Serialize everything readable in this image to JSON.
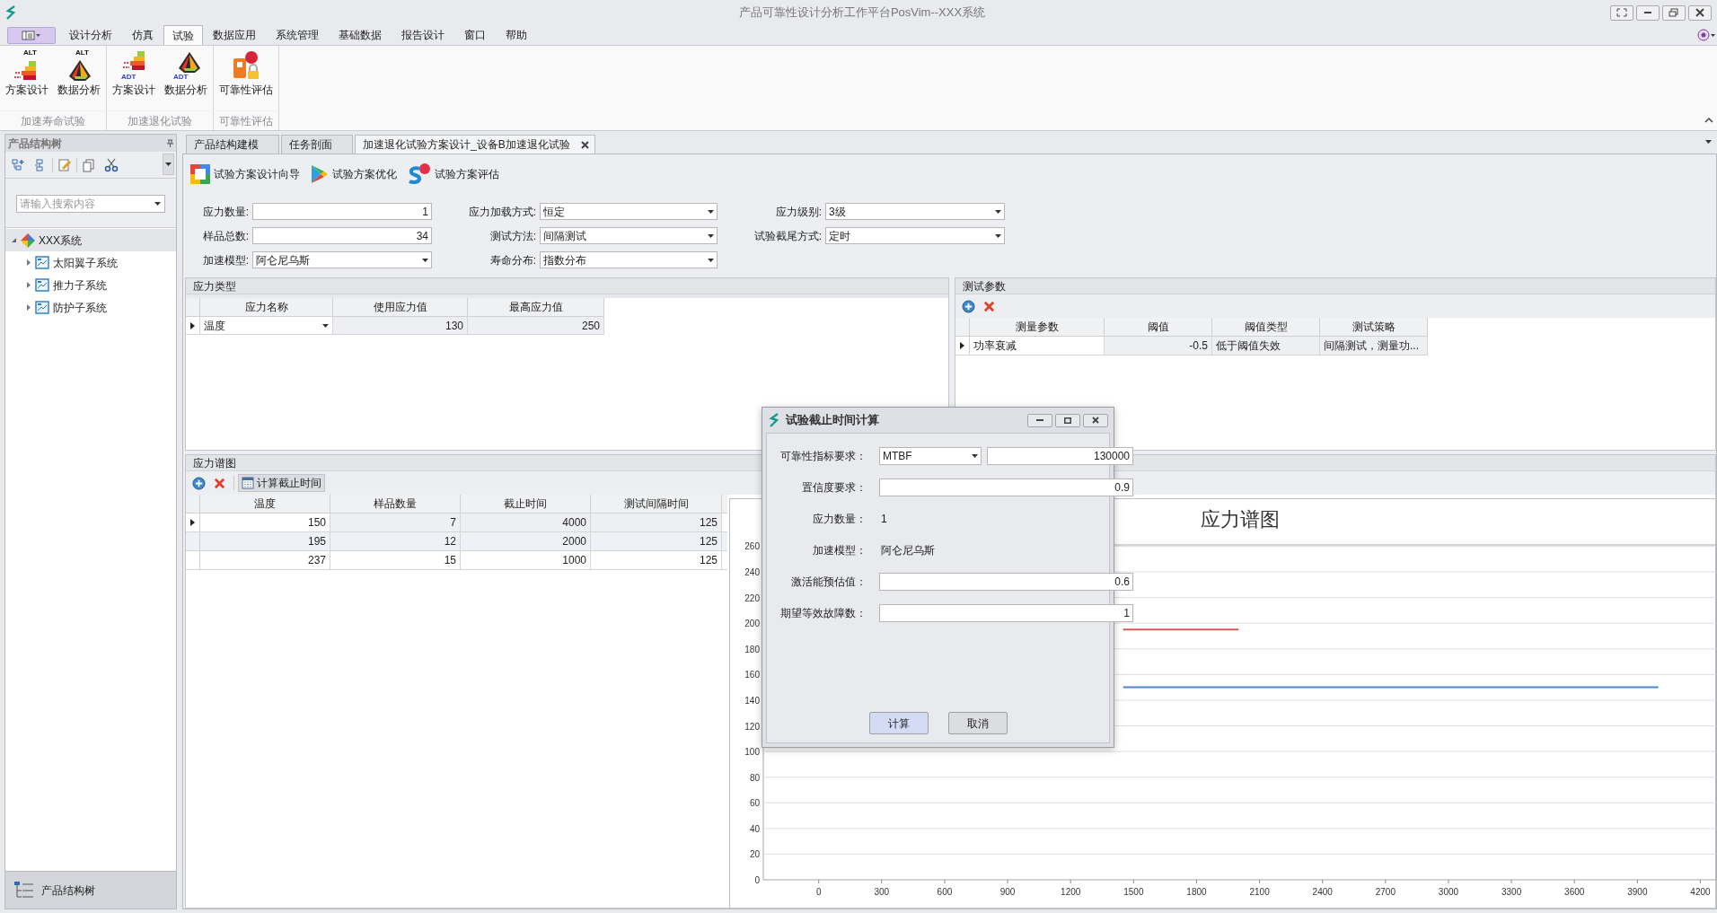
{
  "window": {
    "title": "产品可靠性设计分析工作平台PosVim--XXX系统"
  },
  "menu_tabs": [
    {
      "label": "设计分析",
      "selected": false
    },
    {
      "label": "仿真",
      "selected": false
    },
    {
      "label": "试验",
      "selected": true
    },
    {
      "label": "数据应用",
      "selected": false
    },
    {
      "label": "系统管理",
      "selected": false
    },
    {
      "label": "基础数据",
      "selected": false
    },
    {
      "label": "报告设计",
      "selected": false
    },
    {
      "label": "窗口",
      "selected": false
    },
    {
      "label": "帮助",
      "selected": false
    }
  ],
  "ribbon": {
    "groups": [
      {
        "label": "加速寿命试验",
        "buttons": [
          {
            "label": "方案设计",
            "kind": "design",
            "badge": "ALT"
          },
          {
            "label": "数据分析",
            "kind": "analysis",
            "badge": "ALT"
          }
        ]
      },
      {
        "label": "加速退化试验",
        "buttons": [
          {
            "label": "方案设计",
            "kind": "design",
            "badge": "ADT"
          },
          {
            "label": "数据分析",
            "kind": "analysis",
            "badge": "ADT"
          }
        ]
      },
      {
        "label": "可靠性评估",
        "buttons": [
          {
            "label": "可靠性评估",
            "kind": "reliability"
          }
        ]
      }
    ]
  },
  "left_panel": {
    "title": "产品结构树",
    "search": {
      "placeholder": "请输入搜索内容"
    },
    "tree": [
      {
        "label": "XXX系统",
        "kind": "system",
        "selected": true,
        "expanded": true,
        "children": [
          {
            "label": "太阳翼子系统",
            "kind": "subsystem",
            "selected": false,
            "expanded": false
          },
          {
            "label": "推力子系统",
            "kind": "subsystem",
            "selected": false,
            "expanded": false
          },
          {
            "label": "防护子系统",
            "kind": "subsystem",
            "selected": false,
            "expanded": false
          }
        ]
      }
    ],
    "footer_button": "产品结构树"
  },
  "document_tabs": [
    {
      "label": "产品结构建模",
      "selected": false
    },
    {
      "label": "任务剖面",
      "selected": false
    },
    {
      "label": "加速退化试验方案设计_设备B加速退化试验",
      "selected": true
    }
  ],
  "toolbar": [
    {
      "label": "试验方案设计向导",
      "kind": "wizard"
    },
    {
      "label": "试验方案优化",
      "kind": "optimize"
    },
    {
      "label": "试验方案评估",
      "kind": "evaluate"
    }
  ],
  "form_fields": [
    {
      "label": "应力数量:",
      "kind": "input",
      "value": "1"
    },
    {
      "label": "应力加载方式:",
      "kind": "combo",
      "value": "恒定"
    },
    {
      "label": "应力级别:",
      "kind": "combo",
      "value": "3级"
    },
    {
      "label": "样品总数:",
      "kind": "input",
      "value": "34"
    },
    {
      "label": "测试方法:",
      "kind": "combo",
      "value": "间隔测试"
    },
    {
      "label": "试验截尾方式:",
      "kind": "combo",
      "value": "定时"
    },
    {
      "label": "加速模型:",
      "kind": "combo",
      "value": "阿仑尼乌斯"
    },
    {
      "label": "寿命分布:",
      "kind": "combo",
      "value": "指数分布"
    }
  ],
  "stress_types": {
    "title": "应力类型",
    "columns": [
      "应力名称",
      "使用应力值",
      "最高应力值"
    ],
    "rows": [
      {
        "cells": [
          "温度",
          "130",
          "250"
        ],
        "selected": true
      }
    ]
  },
  "test_params": {
    "title": "测试参数",
    "columns": [
      "测量参数",
      "阈值",
      "阈值类型",
      "测试策略"
    ],
    "rows": [
      {
        "cells": [
          "功率衰减",
          "-0.5",
          "低于阈值失效",
          "间隔测试，测量功..."
        ],
        "selected": true
      }
    ]
  },
  "stress_spectrum": {
    "title": "应力谱图",
    "toolbar_button": "计算截止时间",
    "columns": [
      "温度",
      "样品数量",
      "截止时间",
      "测试间隔时间"
    ],
    "rows": [
      {
        "cells": [
          "150",
          "7",
          "4000",
          "125"
        ],
        "selected": true
      },
      {
        "cells": [
          "195",
          "12",
          "2000",
          "125"
        ],
        "selected": false
      },
      {
        "cells": [
          "237",
          "15",
          "1000",
          "125"
        ],
        "selected": false
      }
    ],
    "chart_data": {
      "type": "line",
      "title": "应力谱图",
      "grid": true,
      "x": [
        1450,
        2000,
        4000
      ],
      "series": [
        {
          "color": "#d65a55",
          "values": [
            195,
            195,
            null
          ]
        },
        {
          "color": "#4f84d2",
          "values": [
            150,
            150,
            150
          ]
        }
      ],
      "xlim": [
        -264,
        4275
      ],
      "ylim": [
        0,
        261
      ],
      "xticks": [
        0,
        300,
        600,
        900,
        1200,
        1500,
        1800,
        2100,
        2400,
        2700,
        3000,
        3300,
        3600,
        3900,
        4200
      ],
      "yticks": [
        0,
        20,
        40,
        60,
        80,
        100,
        120,
        140,
        160,
        180,
        200,
        220,
        240,
        260
      ]
    }
  },
  "dialog": {
    "title": "试验截止时间计算",
    "fields": [
      {
        "label": "可靠性指标要求：",
        "kind": "combo-input",
        "option": "MTBF",
        "value": "130000"
      },
      {
        "label": "置信度要求：",
        "kind": "input",
        "value": "0.9"
      },
      {
        "label": "应力数量：",
        "kind": "text",
        "value": "1"
      },
      {
        "label": "加速模型：",
        "kind": "text",
        "value": "阿仑尼乌斯"
      },
      {
        "label": "激活能预估值：",
        "kind": "input",
        "value": "0.6"
      },
      {
        "label": "期望等效故障数：",
        "kind": "input",
        "value": "1"
      }
    ],
    "buttons": [
      {
        "label": "计算",
        "primary": true
      },
      {
        "label": "取消",
        "primary": false
      }
    ]
  }
}
